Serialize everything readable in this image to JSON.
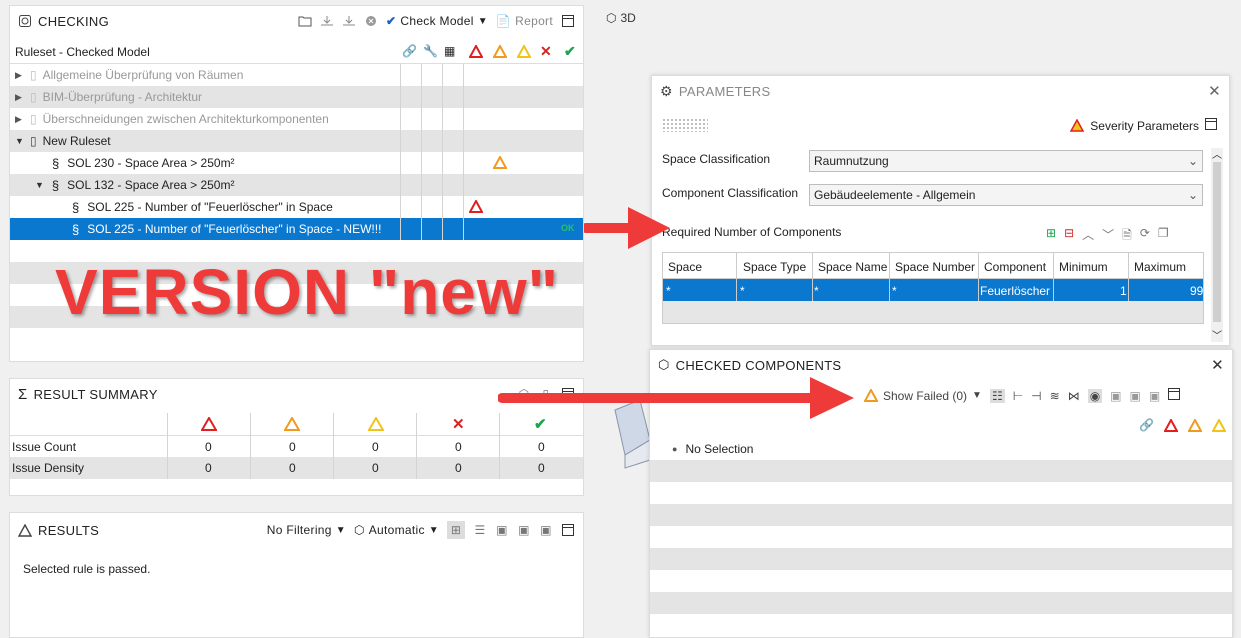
{
  "viewport_label": "3D",
  "checking": {
    "title": "CHECKING",
    "check_model_label": "Check Model",
    "report_label": "Report",
    "ruleset_header": "Ruleset - Checked Model",
    "rows": [
      {
        "label": "Allgemeine Überprüfung von Räumen",
        "indent": 0,
        "expander": "▸",
        "muted": true,
        "status": ""
      },
      {
        "label": "BIM-Überprüfung - Architektur",
        "indent": 0,
        "expander": "▸",
        "muted": true,
        "status": ""
      },
      {
        "label": "Überschneidungen zwischen Architekturkomponenten",
        "indent": 0,
        "expander": "▸",
        "muted": true,
        "status": ""
      },
      {
        "label": "New Ruleset",
        "indent": 0,
        "expander": "▾",
        "muted": false,
        "status": ""
      },
      {
        "label": "SOL 230 - Space Area > 250m²",
        "indent": 1,
        "expander": "",
        "muted": false,
        "status": "moderate"
      },
      {
        "label": "SOL 132 - Space Area > 250m²",
        "indent": 1,
        "expander": "▾",
        "muted": false,
        "status": ""
      },
      {
        "label": "SOL 225 - Number of \"Feuerlöscher\" in Space",
        "indent": 2,
        "expander": "",
        "muted": false,
        "status": "critical"
      },
      {
        "label": "SOL 225 - Number of \"Feuerlöscher\" in Space - NEW!!!",
        "indent": 2,
        "expander": "",
        "muted": false,
        "status": "ok",
        "selected": true
      }
    ],
    "ok_label": "OK"
  },
  "overlay_text": "VERSION \"new\"",
  "result_summary": {
    "title": "RESULT SUMMARY",
    "rows": [
      {
        "label": "Issue Count",
        "values": [
          "0",
          "0",
          "0",
          "0",
          "0"
        ]
      },
      {
        "label": "Issue Density",
        "values": [
          "0",
          "0",
          "0",
          "0",
          "0"
        ]
      }
    ]
  },
  "results": {
    "title": "RESULTS",
    "filter_label": "No Filtering",
    "mode_label": "Automatic",
    "message": "Selected rule is passed."
  },
  "parameters": {
    "title": "PARAMETERS",
    "severity_label": "Severity Parameters",
    "space_classification_label": "Space Classification",
    "space_classification_value": "Raumnutzung",
    "component_classification_label": "Component Classification",
    "component_classification_value": "Gebäudeelemente - Allgemein",
    "required_label": "Required Number of Components",
    "columns": [
      "Space",
      "Space Type",
      "Space Name",
      "Space Number",
      "Component",
      "Minimum",
      "Maximum"
    ],
    "row": [
      "*",
      "*",
      "*",
      "*",
      "Feuerlöscher",
      "1",
      "99"
    ]
  },
  "checked_components": {
    "title": "CHECKED COMPONENTS",
    "show_failed_label": "Show Failed (0)",
    "no_selection_label": "No Selection"
  },
  "colors": {
    "critical": "#e02020",
    "moderate": "#f29a1e",
    "minor": "#f0c419",
    "error": "#d42525",
    "ok": "#1aa64a",
    "selection": "#0b78d0",
    "arrow": "#ef3a3a"
  }
}
